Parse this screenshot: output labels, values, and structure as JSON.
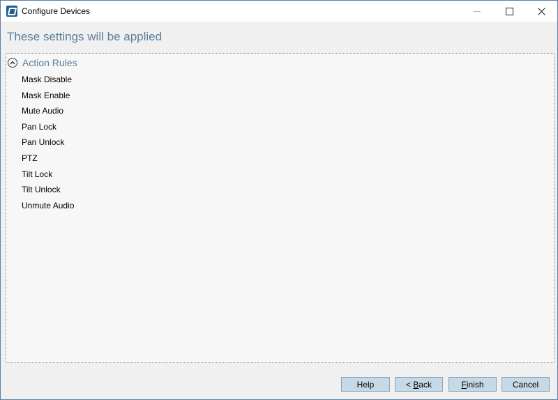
{
  "window": {
    "title": "Configure Devices",
    "icon": "app-icon",
    "controls": [
      "minimize-icon",
      "maximize-icon",
      "close-icon"
    ]
  },
  "heading": "These settings will be applied",
  "section": {
    "title": "Action Rules",
    "toggle_icon": "chevron-up-circle-icon",
    "items": [
      "Mask Disable",
      "Mask Enable",
      "Mute Audio",
      "Pan Lock",
      "Pan Unlock",
      "PTZ",
      "Tilt Lock",
      "Tilt Unlock",
      "Unmute Audio"
    ]
  },
  "buttons": {
    "help": "Help",
    "back_prefix": "< ",
    "back_mnemonic": "B",
    "back_rest": "ack",
    "finish_mnemonic": "F",
    "finish_rest": "inish",
    "cancel": "Cancel"
  },
  "colors": {
    "heading": "#5a7f9c",
    "button_bg": "#c6d9e7",
    "button_border": "#8aa4b9",
    "window_border": "#5b7fa6"
  }
}
